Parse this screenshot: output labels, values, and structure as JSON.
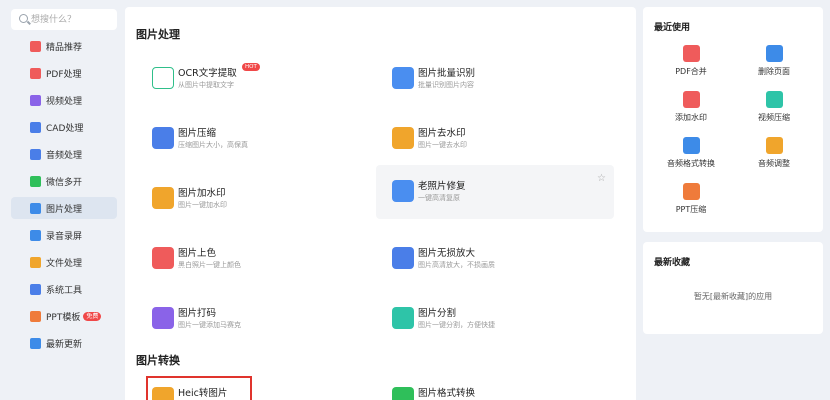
{
  "sidebar": {
    "search_placeholder": "想搜什么？",
    "items": [
      {
        "label": "精品推荐",
        "color": "#ef5b5b"
      },
      {
        "label": "PDF处理",
        "color": "#ef5b5b"
      },
      {
        "label": "视频处理",
        "color": "#8a63e8"
      },
      {
        "label": "CAD处理",
        "color": "#4a7ee8"
      },
      {
        "label": "音频处理",
        "color": "#4a7ee8"
      },
      {
        "label": "微信多开",
        "color": "#2fbf5a"
      },
      {
        "label": "图片处理",
        "color": "#3d8be8"
      },
      {
        "label": "录音录屏",
        "color": "#3d8be8"
      },
      {
        "label": "文件处理",
        "color": "#f0a52c"
      },
      {
        "label": "系统工具",
        "color": "#4a7ee8"
      },
      {
        "label": "PPT模板",
        "color": "#ef7b3b",
        "badge": "免费"
      },
      {
        "label": "最新更新",
        "color": "#3d8be8"
      }
    ]
  },
  "main": {
    "section1_title": "图片处理",
    "section2_title": "图片转换",
    "hot_label": "HOT",
    "tools": [
      {
        "name": "OCR文字提取",
        "desc": "从图片中提取文字",
        "color": "#ffffff"
      },
      {
        "name": "图片批量识别",
        "desc": "批量识别图片内容",
        "color": "#4a8ef0"
      },
      {
        "name": "图片压缩",
        "desc": "压缩图片大小，高保真",
        "color": "#4a7ee8"
      },
      {
        "name": "图片去水印",
        "desc": "图片一键去水印",
        "color": "#f0a52c"
      },
      {
        "name": "图片加水印",
        "desc": "图片一键加水印",
        "color": "#f0a52c"
      },
      {
        "name": "老照片修复",
        "desc": "一键高清复原",
        "color": "#4a8ef0"
      },
      {
        "name": "图片上色",
        "desc": "黑白照片一键上颜色",
        "color": "#ef5b5b"
      },
      {
        "name": "图片无损放大",
        "desc": "图片高清放大，不损画质",
        "color": "#4a7ee8"
      },
      {
        "name": "图片打码",
        "desc": "图片一键添加马赛克",
        "color": "#8a63e8"
      },
      {
        "name": "图片分割",
        "desc": "图片一键分割，方便快捷",
        "color": "#2ec4a8"
      },
      {
        "name": "Heic转图片",
        "desc": "",
        "color": "#f0a52c"
      },
      {
        "name": "图片格式转换",
        "desc": "",
        "color": "#2fbf5a"
      }
    ]
  },
  "recent": {
    "title": "最近使用",
    "items": [
      {
        "label": "PDF合并",
        "color": "#ef5b5b"
      },
      {
        "label": "删除页面",
        "color": "#3d8be8"
      },
      {
        "label": "添加水印",
        "color": "#ef5b5b"
      },
      {
        "label": "视频压缩",
        "color": "#2ec4a8"
      },
      {
        "label": "音频格式转换",
        "color": "#3d8be8"
      },
      {
        "label": "音频调整",
        "color": "#f0a52c"
      },
      {
        "label": "PPT压缩",
        "color": "#ef7b3b"
      }
    ]
  },
  "favorites": {
    "title": "最新收藏",
    "empty_text": "暂无[最新收藏]的应用"
  }
}
